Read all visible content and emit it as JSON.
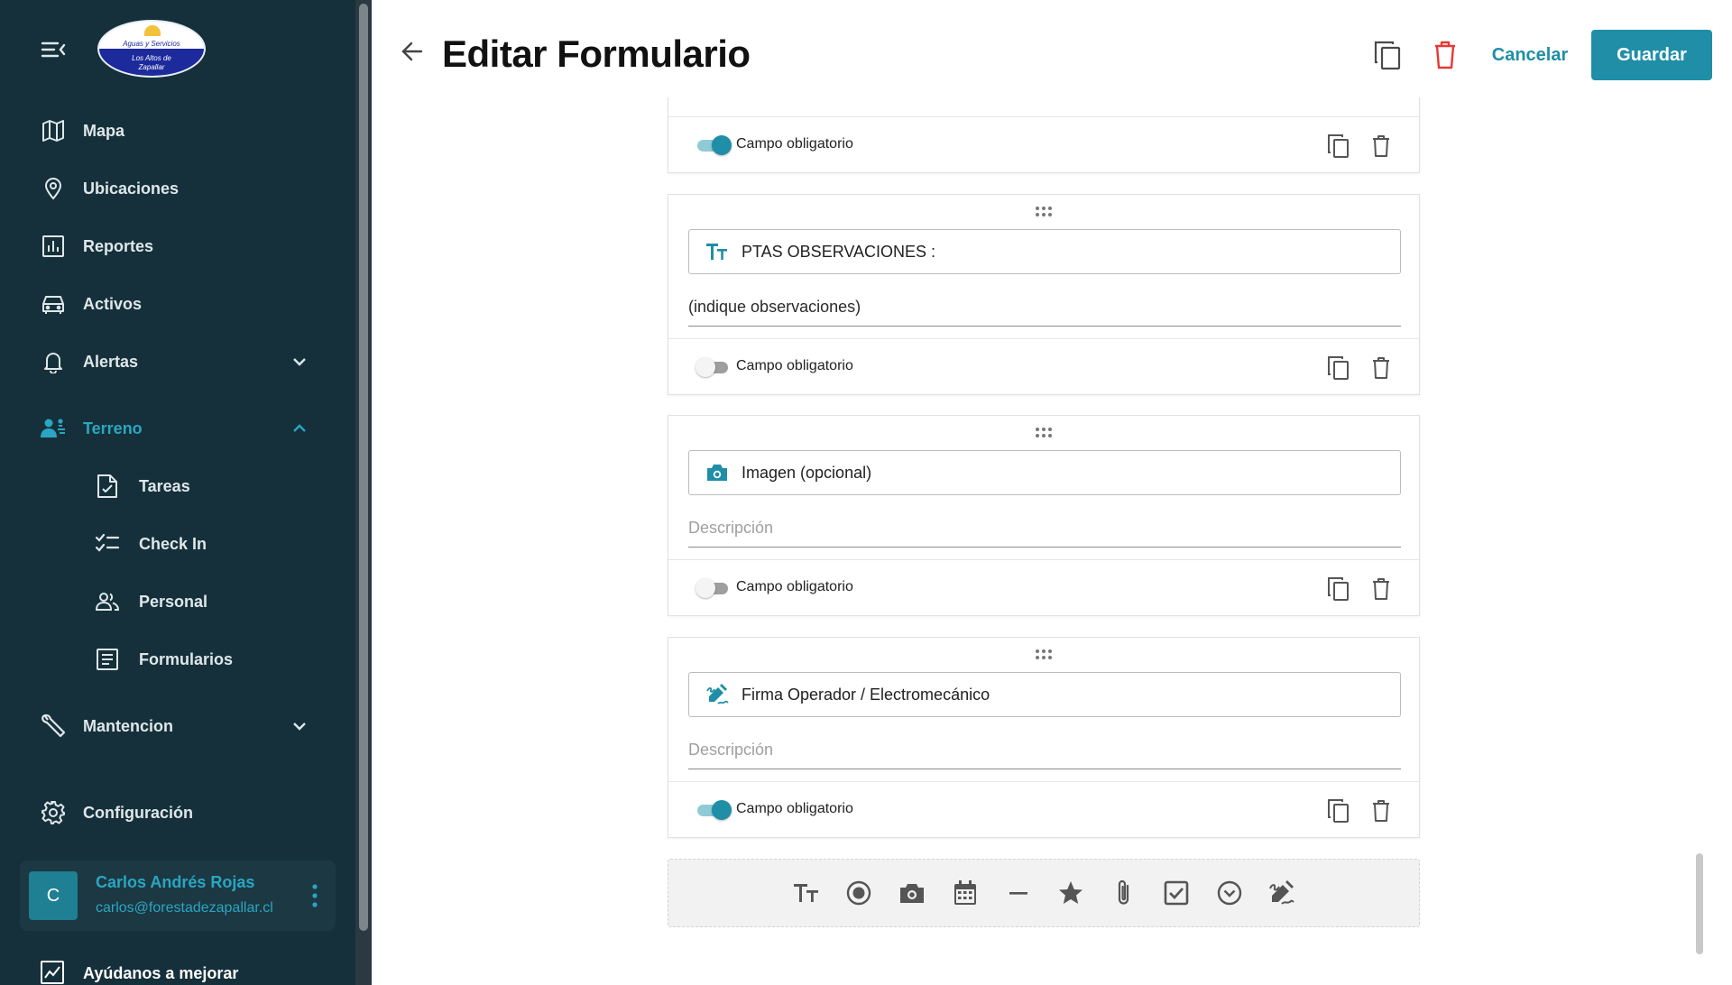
{
  "sidebar": {
    "logo_line1": "Aguas y Servicios",
    "logo_line2": "Los Altos de",
    "logo_line3": "Zapallar",
    "items": [
      {
        "label": "Mapa"
      },
      {
        "label": "Ubicaciones"
      },
      {
        "label": "Reportes"
      },
      {
        "label": "Activos"
      },
      {
        "label": "Alertas"
      },
      {
        "label": "Terreno"
      },
      {
        "label": "Mantencion"
      },
      {
        "label": "Configuración"
      }
    ],
    "terreno_sub": [
      {
        "label": "Tareas"
      },
      {
        "label": "Check In"
      },
      {
        "label": "Personal"
      },
      {
        "label": "Formularios"
      }
    ],
    "user": {
      "initial": "C",
      "name": "Carlos Andrés Rojas",
      "email": "carlos@forestadezapallar.cl"
    },
    "help_label": "Ayúdanos a mejorar"
  },
  "header": {
    "title": "Editar Formulario",
    "cancel_label": "Cancelar",
    "save_label": "Guardar"
  },
  "fields": [
    {
      "required_label": "Campo obligatorio",
      "required": true
    },
    {
      "type": "text",
      "title": "PTAS OBSERVACIONES :",
      "description": "(indique observaciones)",
      "required_label": "Campo obligatorio",
      "required": false
    },
    {
      "type": "image",
      "title": "Imagen (opcional)",
      "description_placeholder": "Descripción",
      "required_label": "Campo obligatorio",
      "required": false
    },
    {
      "type": "signature",
      "title": "Firma Operador / Electromecánico",
      "description_placeholder": "Descripción",
      "required_label": "Campo obligatorio",
      "required": true
    }
  ],
  "colors": {
    "sidebar_bg": "#15303a",
    "accent": "#1f8ea6",
    "danger": "#e53935"
  }
}
